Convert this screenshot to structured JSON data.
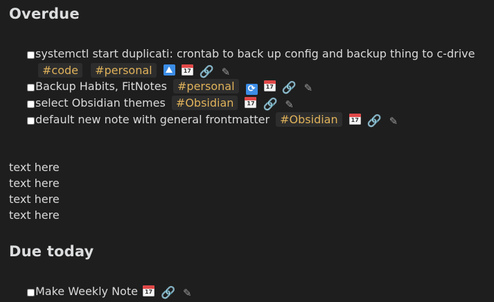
{
  "sections": {
    "overdue": {
      "heading": "Overdue",
      "tasks": [
        {
          "text": "systemctl start duplicati: crontab to back up config and backup thing to c-drive",
          "tags": [
            "#code",
            "#personal"
          ]
        },
        {
          "text": "Backup Habits, FitNotes",
          "tags": [
            "#personal"
          ]
        },
        {
          "text": "select Obsidian themes",
          "tags": [
            "#Obsidian"
          ]
        },
        {
          "text": "default new note with general frontmatter",
          "tags": [
            "#Obsidian"
          ]
        }
      ]
    },
    "due_today": {
      "heading": "Due today",
      "tasks": [
        {
          "text": "Make Weekly Note"
        }
      ]
    }
  },
  "body_text": [
    "text here",
    "text here",
    "text here",
    "text here"
  ],
  "icons": {
    "calendar": "calendar-icon",
    "link": "link-icon",
    "edit": "pencil-icon",
    "priority_high": "up-arrow-priority-icon",
    "recurring": "repeat-icon"
  },
  "colors": {
    "background": "#1e1e1e",
    "text": "#dadada",
    "tag_text": "#e0b25a",
    "tag_bg": "#2d2d2d",
    "accent_blue": "#3c8de6"
  }
}
